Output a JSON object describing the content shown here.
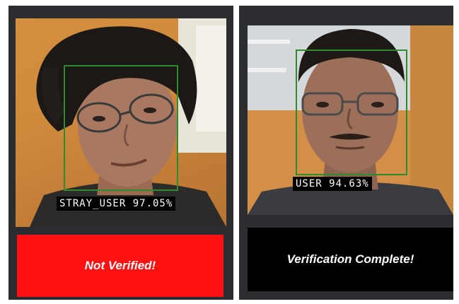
{
  "panels": [
    {
      "label": "STRAY_USER 97.05%",
      "status": "Not Verified!",
      "status_color": "#ff1111"
    },
    {
      "label": "USER 94.63%",
      "status": "Verification Complete!",
      "status_color": "#000000"
    }
  ],
  "colors": {
    "panel_bg": "#2b2d30",
    "face_box": "#2e8b2e"
  }
}
